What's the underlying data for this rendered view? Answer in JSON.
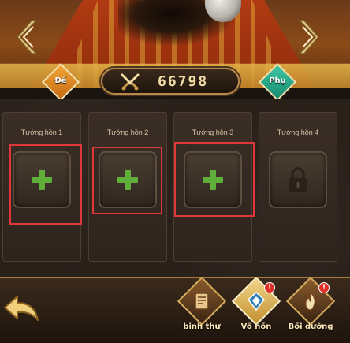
{
  "header": {
    "power_value": "66798",
    "badge_left": "Đế",
    "badge_right": "Phụ"
  },
  "slots": [
    {
      "title": "Tướng hồn 1",
      "state": "add",
      "icon": "plus-icon"
    },
    {
      "title": "Tướng hồn 2",
      "state": "add",
      "icon": "plus-icon"
    },
    {
      "title": "Tướng hồn 3",
      "state": "add",
      "icon": "plus-icon"
    },
    {
      "title": "Tướng hồn 4",
      "state": "locked",
      "icon": "lock-icon"
    }
  ],
  "bottom_menu": [
    {
      "label": "binh thư",
      "icon": "scroll-icon",
      "alert": false
    },
    {
      "label": "Võ hồn",
      "icon": "crest-icon",
      "alert": true,
      "alert_text": "!"
    },
    {
      "label": "Bồi dưỡng",
      "icon": "flame-icon",
      "alert": true,
      "alert_text": "!"
    }
  ],
  "colors": {
    "plus_green": "#5fae3a",
    "highlight_red": "#e0383a",
    "gold": "#d6ad5e"
  }
}
